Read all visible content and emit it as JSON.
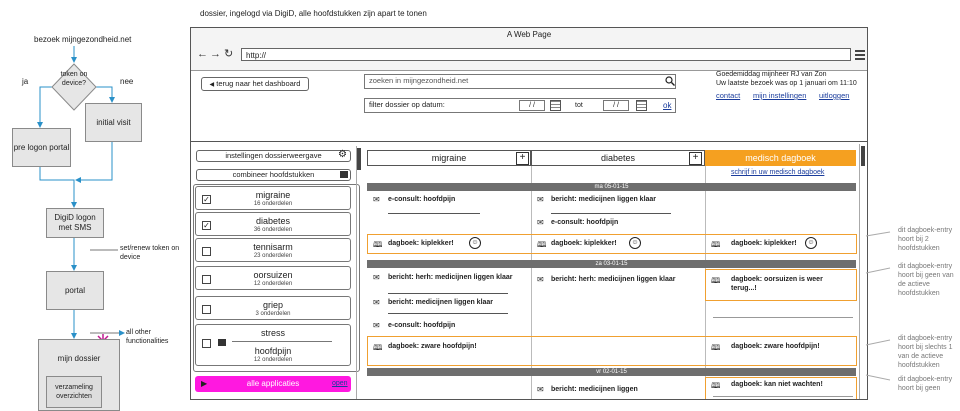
{
  "caption": "dossier, ingelogd via DigiD, alle hoofdstukken zijn apart te tonen",
  "flow": {
    "start": "bezoek mijngezondheid.net",
    "decision": "token on device?",
    "yes": "ja",
    "no": "nee",
    "initial_visit": "initial visit",
    "pre_logon": "pre logon portal",
    "digid": "DigiD logon met SMS",
    "set_token": "set/renew token on device",
    "portal": "portal",
    "other": "all other functionalities",
    "mijn_dossier": "mijn dossier",
    "verzameling": "verzameling overzichten"
  },
  "browser": {
    "title": "A Web Page",
    "url": "http://",
    "back_button": "terug naar het dashboard",
    "search_placeholder": "zoeken in mijngezondheid.net",
    "filter_label": "filter dossier op datum:",
    "date_from": "/ /",
    "date_to": "/ /",
    "tot": "tot",
    "ok": "ok",
    "greeting": "Goedemiddag mijnheer RJ van Zon",
    "last_visit": "Uw laatste bezoek was op 1 januari om 11:10",
    "links": [
      "contact",
      "mijn instellingen",
      "uitloggen"
    ]
  },
  "sidebar": {
    "settings": "instellingen dossierweergave",
    "combine": "combineer hoofdstukken",
    "items": [
      {
        "name": "migraine",
        "sub": "16 onderdelen",
        "checked": true
      },
      {
        "name": "diabetes",
        "sub": "36 onderdelen",
        "checked": true
      },
      {
        "name": "tennisarm",
        "sub": "23 onderdelen",
        "checked": false
      },
      {
        "name": "oorsuizen",
        "sub": "12 onderdelen",
        "checked": false
      },
      {
        "name": "griep",
        "sub": "3 onderdelen",
        "checked": false
      },
      {
        "name": "stress",
        "sub": "",
        "checked": false
      },
      {
        "name": "hoofdpijn",
        "sub": "12 onderdelen",
        "checked": false
      }
    ],
    "apps": "alle applicaties",
    "apps_link": "open"
  },
  "columns": {
    "migraine": "migraine",
    "diabetes": "diabetes",
    "dagboek": "medisch dagboek",
    "dagboek_link": "schrijf in uw medisch dagboek"
  },
  "dates": [
    "ma 05-01-15",
    "za 03-01-15",
    "vr 02-01-15"
  ],
  "entries": {
    "e1": "e-consult: hoofdpijn",
    "e2": "bericht: medicijnen liggen klaar",
    "e3": "e-consult: hoofdpijn",
    "d1": "dagboek: kiplekker!",
    "e4": "bericht: herh: medicijnen liggen klaar",
    "e5": "bericht: medicijnen liggen klaar",
    "e6": "e-consult: hoofdpijn",
    "e7": "bericht: herh: medicijnen liggen klaar",
    "e8": "dagboek: oorsuizen is weer terug...!",
    "d2": "dagboek: zware hoofdpijn!",
    "e9": "bericht: medicijnen liggen",
    "e10": "dagboek: kan niet wachten!"
  },
  "annotations": [
    "dit dagboek-entry hoort bij 2 hoofdstukken",
    "dit dagboek-entry hoort bij geen van de actieve hoofdstukken",
    "dit dagboek-entry hoort bij slechts 1 van de actieve hoofdstukken",
    "dit dagboek-entry hoort bij geen"
  ]
}
